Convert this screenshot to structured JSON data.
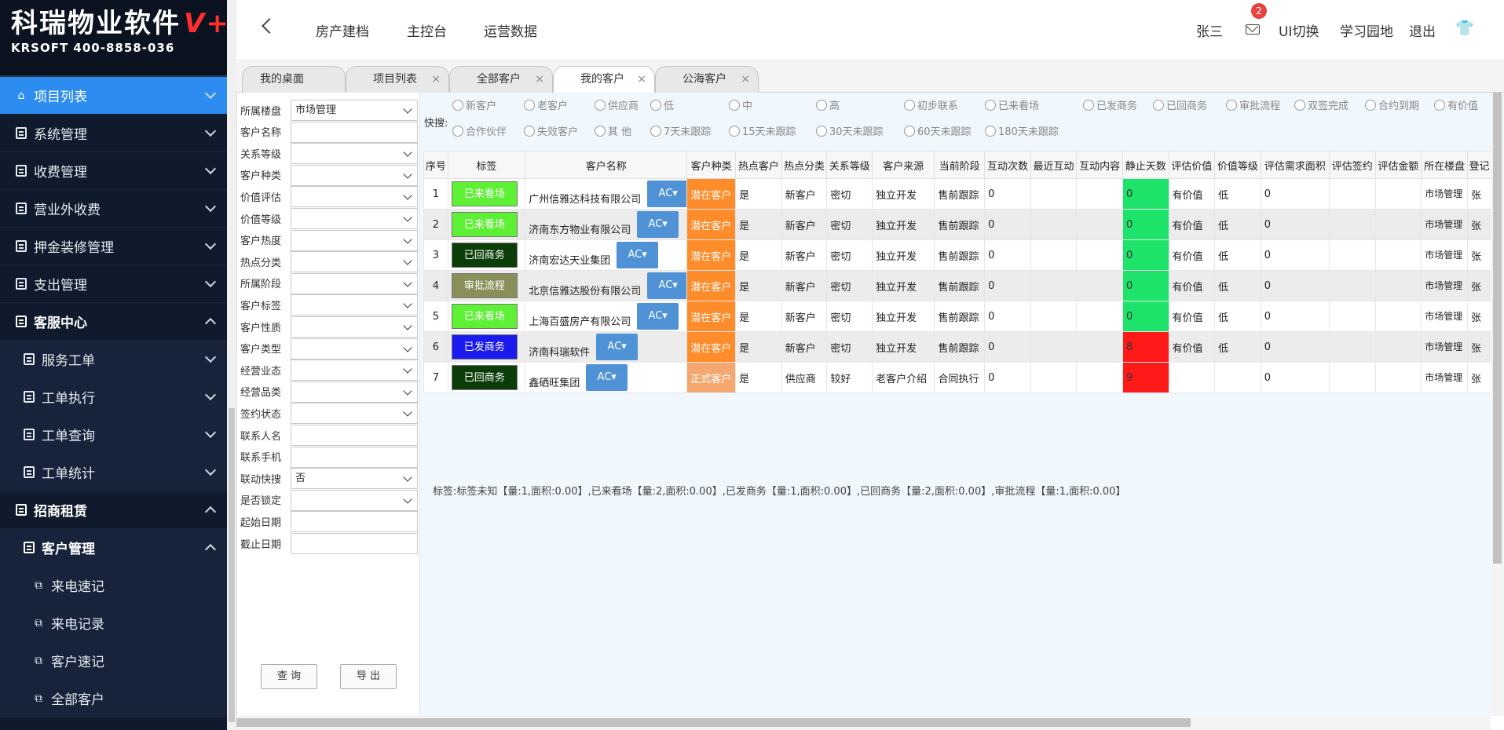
{
  "logo": {
    "brand": "科瑞物业软件",
    "brand_suffix": "V+",
    "sub": "KRSOFT 400-8858-036"
  },
  "sidebar": {
    "items": [
      {
        "label": "项目列表"
      },
      {
        "label": "系统管理"
      },
      {
        "label": "收费管理"
      },
      {
        "label": "营业外收费"
      },
      {
        "label": "押金装修管理"
      },
      {
        "label": "支出管理"
      },
      {
        "label": "客服中心"
      },
      {
        "label": "服务工单"
      },
      {
        "label": "工单执行"
      },
      {
        "label": "工单查询"
      },
      {
        "label": "工单统计"
      },
      {
        "label": "招商租赁"
      },
      {
        "label": "客户管理"
      },
      {
        "label": "来电速记"
      },
      {
        "label": "来电记录"
      },
      {
        "label": "客户速记"
      },
      {
        "label": "全部客户"
      }
    ]
  },
  "header": {
    "nav": [
      "房产建档",
      "主控台",
      "运营数据"
    ],
    "user": "张三",
    "mail_count": "2",
    "ui_switch": "UI切换",
    "learn": "学习园地",
    "logout": "退出"
  },
  "tabs": [
    {
      "label": "我的桌面"
    },
    {
      "label": "项目列表"
    },
    {
      "label": "全部客户"
    },
    {
      "label": "我的客户"
    },
    {
      "label": "公海客户"
    }
  ],
  "filters": {
    "fields": [
      {
        "label": "所属楼盘",
        "value": "市场管理"
      },
      {
        "label": "客户名称",
        "value": ""
      },
      {
        "label": "关系等级",
        "value": ""
      },
      {
        "label": "客户种类",
        "value": ""
      },
      {
        "label": "价值评估",
        "value": ""
      },
      {
        "label": "价值等级",
        "value": ""
      },
      {
        "label": "客户热度",
        "value": ""
      },
      {
        "label": "热点分类",
        "value": ""
      },
      {
        "label": "所属阶段",
        "value": ""
      },
      {
        "label": "客户标签",
        "value": ""
      },
      {
        "label": "客户性质",
        "value": ""
      },
      {
        "label": "客户类型",
        "value": ""
      },
      {
        "label": "经营业态",
        "value": ""
      },
      {
        "label": "经营品类",
        "value": ""
      },
      {
        "label": "签约状态",
        "value": ""
      },
      {
        "label": "联系人名",
        "value": ""
      },
      {
        "label": "联系手机",
        "value": ""
      },
      {
        "label": "联动快搜",
        "value": "否"
      },
      {
        "label": "是否锁定",
        "value": ""
      },
      {
        "label": "起始日期",
        "value": ""
      },
      {
        "label": "截止日期",
        "value": ""
      }
    ],
    "query_label": "查 询",
    "export_label": "导 出"
  },
  "quick": {
    "label": "快搜:",
    "row1": [
      "新客户",
      "老客户",
      "供应商",
      "低",
      "中",
      "高",
      "初步联系",
      "已来看场",
      "已发商务",
      "已回商务",
      "审批流程",
      "双签完成",
      "合约到期",
      "有价值"
    ],
    "row2": [
      "合作伙伴",
      "失效客户",
      "其 他",
      "7天未跟踪",
      "15天未跟踪",
      "30天未跟踪",
      "60天未跟踪",
      "180天未跟踪"
    ]
  },
  "table": {
    "headers": [
      "序号",
      "标签",
      "客户名称",
      "客户种类",
      "热点客户",
      "热点分类",
      "关系等级",
      "客户来源",
      "当前阶段",
      "互动次数",
      "最近互动",
      "互动内容",
      "静止天数",
      "评估价值",
      "价值等级",
      "评估需求面积",
      "评估签约",
      "评估金额",
      "所在楼盘",
      "登记"
    ],
    "ac_label": "AC",
    "rows": [
      {
        "seq": "1",
        "tag": "已来看场",
        "tag_color": "#5ef035",
        "name": "广州信雅达科技有限公司",
        "kind": "潜在客户",
        "kind_color": "#ff8c2a",
        "hot": "是",
        "hot_cat": "新客户",
        "relation": "密切",
        "source": "独立开发",
        "stage": "售前跟踪",
        "interactions": "0",
        "still": "0",
        "still_color": "#1ee36a",
        "value": "有价值",
        "level": "低",
        "area": "0",
        "building": "市场管理",
        "reg": "张"
      },
      {
        "seq": "2",
        "tag": "已来看场",
        "tag_color": "#5ef035",
        "name": "济南东方物业有限公司",
        "kind": "潜在客户",
        "kind_color": "#ff8c2a",
        "hot": "是",
        "hot_cat": "新客户",
        "relation": "密切",
        "source": "独立开发",
        "stage": "售前跟踪",
        "interactions": "0",
        "still": "0",
        "still_color": "#1ee36a",
        "value": "有价值",
        "level": "低",
        "area": "0",
        "building": "市场管理",
        "reg": "张"
      },
      {
        "seq": "3",
        "tag": "已回商务",
        "tag_color": "#0a3d08",
        "name": "济南宏达天业集团",
        "kind": "潜在客户",
        "kind_color": "#ff8c2a",
        "hot": "是",
        "hot_cat": "新客户",
        "relation": "密切",
        "source": "独立开发",
        "stage": "售前跟踪",
        "interactions": "0",
        "still": "0",
        "still_color": "#1ee36a",
        "value": "有价值",
        "level": "低",
        "area": "0",
        "building": "市场管理",
        "reg": "张"
      },
      {
        "seq": "4",
        "tag": "审批流程",
        "tag_color": "#8a8f5a",
        "name": "北京信雅达股份有限公司",
        "kind": "潜在客户",
        "kind_color": "#ff8c2a",
        "hot": "是",
        "hot_cat": "新客户",
        "relation": "密切",
        "source": "独立开发",
        "stage": "售前跟踪",
        "interactions": "0",
        "still": "0",
        "still_color": "#1ee36a",
        "value": "有价值",
        "level": "低",
        "area": "0",
        "building": "市场管理",
        "reg": "张"
      },
      {
        "seq": "5",
        "tag": "已来看场",
        "tag_color": "#5ef035",
        "name": "上海百盛房产有限公司",
        "kind": "潜在客户",
        "kind_color": "#ff8c2a",
        "hot": "是",
        "hot_cat": "新客户",
        "relation": "密切",
        "source": "独立开发",
        "stage": "售前跟踪",
        "interactions": "0",
        "still": "0",
        "still_color": "#1ee36a",
        "value": "有价值",
        "level": "低",
        "area": "0",
        "building": "市场管理",
        "reg": "张"
      },
      {
        "seq": "6",
        "tag": "已发商务",
        "tag_color": "#1a1aee",
        "name": "济南科瑞软件",
        "kind": "潜在客户",
        "kind_color": "#ff8c2a",
        "hot": "是",
        "hot_cat": "新客户",
        "relation": "密切",
        "source": "独立开发",
        "stage": "售前跟踪",
        "interactions": "0",
        "still": "8",
        "still_color": "#ff1a1a",
        "value": "有价值",
        "level": "低",
        "area": "0",
        "building": "市场管理",
        "reg": "张"
      },
      {
        "seq": "7",
        "tag": "已回商务",
        "tag_color": "#0a3d08",
        "name": "鑫硒旺集团",
        "kind": "正式客户",
        "kind_color": "#f4a870",
        "hot": "是",
        "hot_cat": "供应商",
        "relation": "较好",
        "source": "老客户介绍",
        "stage": "合同执行",
        "interactions": "0",
        "still": "9",
        "still_color": "#ff1a1a",
        "value": "",
        "level": "",
        "area": "0",
        "building": "市场管理",
        "reg": "张"
      }
    ]
  },
  "tag_summary": "标签:标签未知【量:1,面积:0.00】,已来看场【量:2,面积:0.00】,已发商务【量:1,面积:0.00】,已回商务【量:2,面积:0.00】,审批流程【量:1,面积:0.00】"
}
